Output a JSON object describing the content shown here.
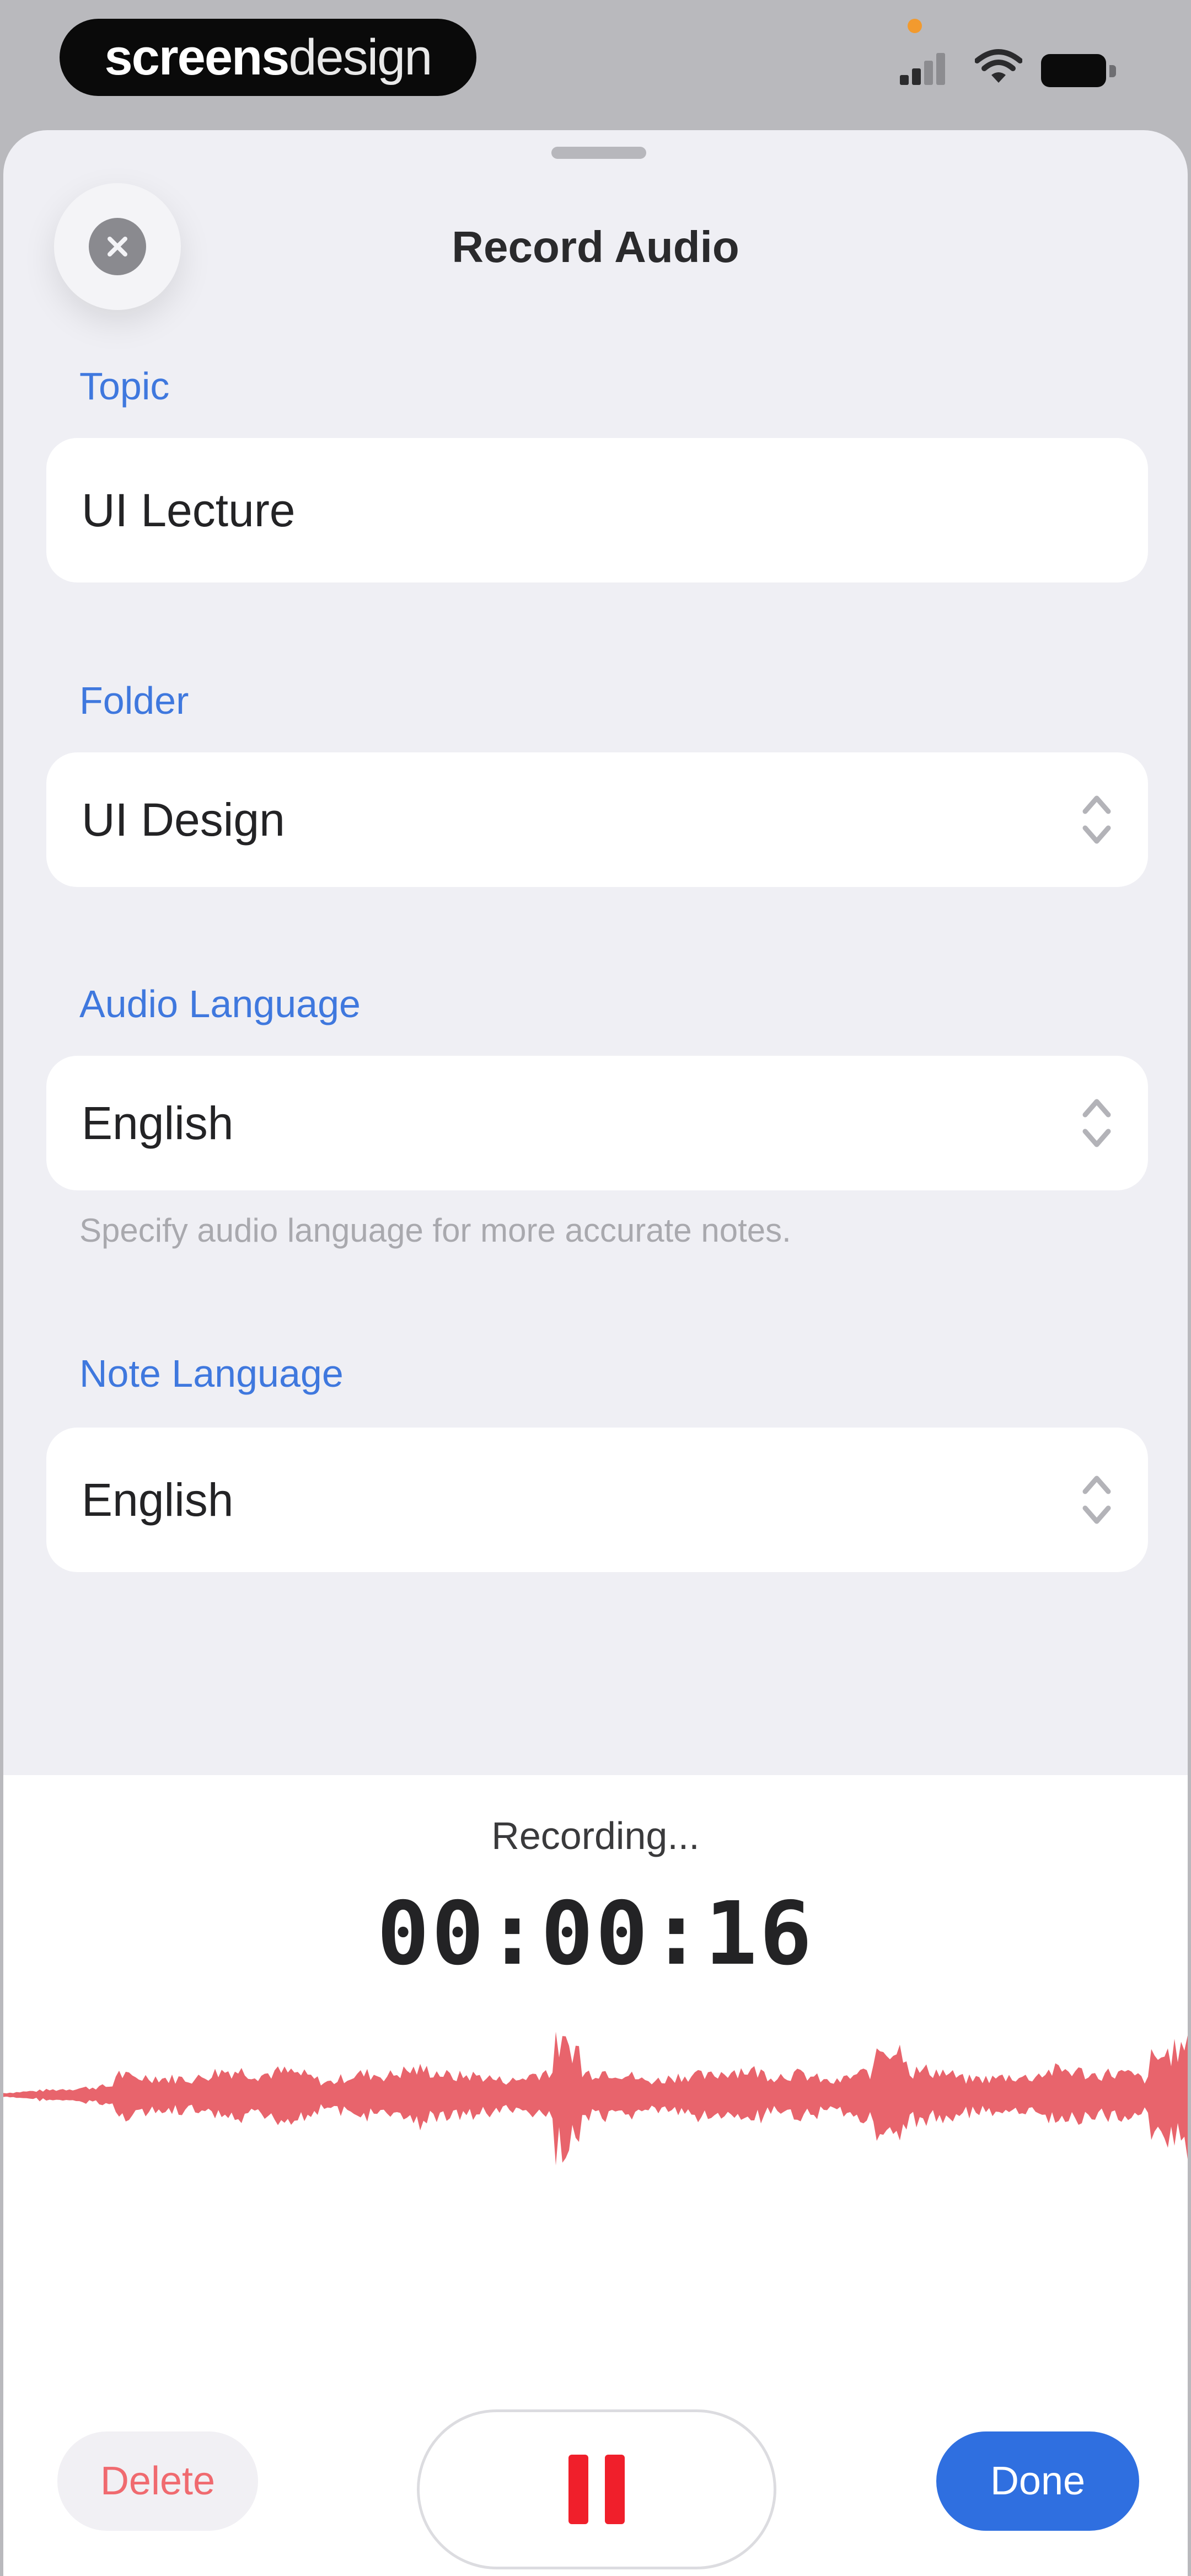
{
  "status_bar": {
    "brand_bold": "screens",
    "brand_light": "design",
    "icons": [
      "signal-icon",
      "wifi-icon",
      "battery-icon"
    ]
  },
  "sheet": {
    "title": "Record Audio",
    "close_icon": "close-icon"
  },
  "form": {
    "topic_label": "Topic",
    "topic_value": "UI Lecture",
    "folder_label": "Folder",
    "folder_value": "UI Design",
    "audio_language_label": "Audio Language",
    "audio_language_value": "English",
    "audio_language_helper": "Specify audio language for more accurate notes.",
    "note_language_label": "Note Language",
    "note_language_value": "English"
  },
  "recording": {
    "status": "Recording...",
    "timer": "00:00:16"
  },
  "actions": {
    "delete_label": "Delete",
    "pause_icon": "pause-icon",
    "done_label": "Done"
  },
  "colors": {
    "accent_blue": "#3f78de",
    "done_blue": "#2f6fe0",
    "record_red": "#f01f2b",
    "waveform_red": "#e8646c",
    "delete_text": "#f06a6f"
  }
}
